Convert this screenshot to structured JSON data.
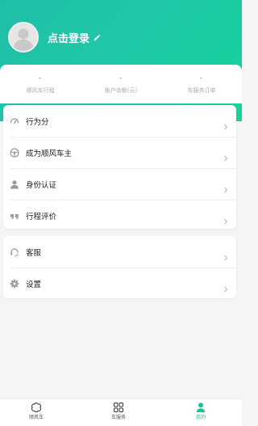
{
  "header": {
    "login_label": "点击登录",
    "gradient_start": "#1fbfa6",
    "gradient_end": "#14d39a"
  },
  "stats": [
    {
      "value": "-",
      "label": "顺风车行程"
    },
    {
      "value": "-",
      "label": "账户余额(元)"
    },
    {
      "value": "-",
      "label": "车服务订单"
    }
  ],
  "menu_group_1": [
    {
      "label": "行为分",
      "icon": "gauge-icon"
    },
    {
      "label": "成为顺风车主",
      "icon": "steering-wheel-icon"
    },
    {
      "label": "身份认证",
      "icon": "person-icon"
    },
    {
      "label": "行程评价",
      "icon": "quote-icon"
    }
  ],
  "menu_group_2": [
    {
      "label": "客服",
      "icon": "headset-icon"
    },
    {
      "label": "设置",
      "icon": "gear-icon"
    }
  ],
  "tabbar": {
    "active": "我的",
    "accent": "#19c29a",
    "tabs": [
      {
        "label": "顺风车",
        "icon": "rideshare-icon"
      },
      {
        "label": "车服务",
        "icon": "grid-icon"
      },
      {
        "label": "我的",
        "icon": "profile-icon"
      }
    ]
  }
}
